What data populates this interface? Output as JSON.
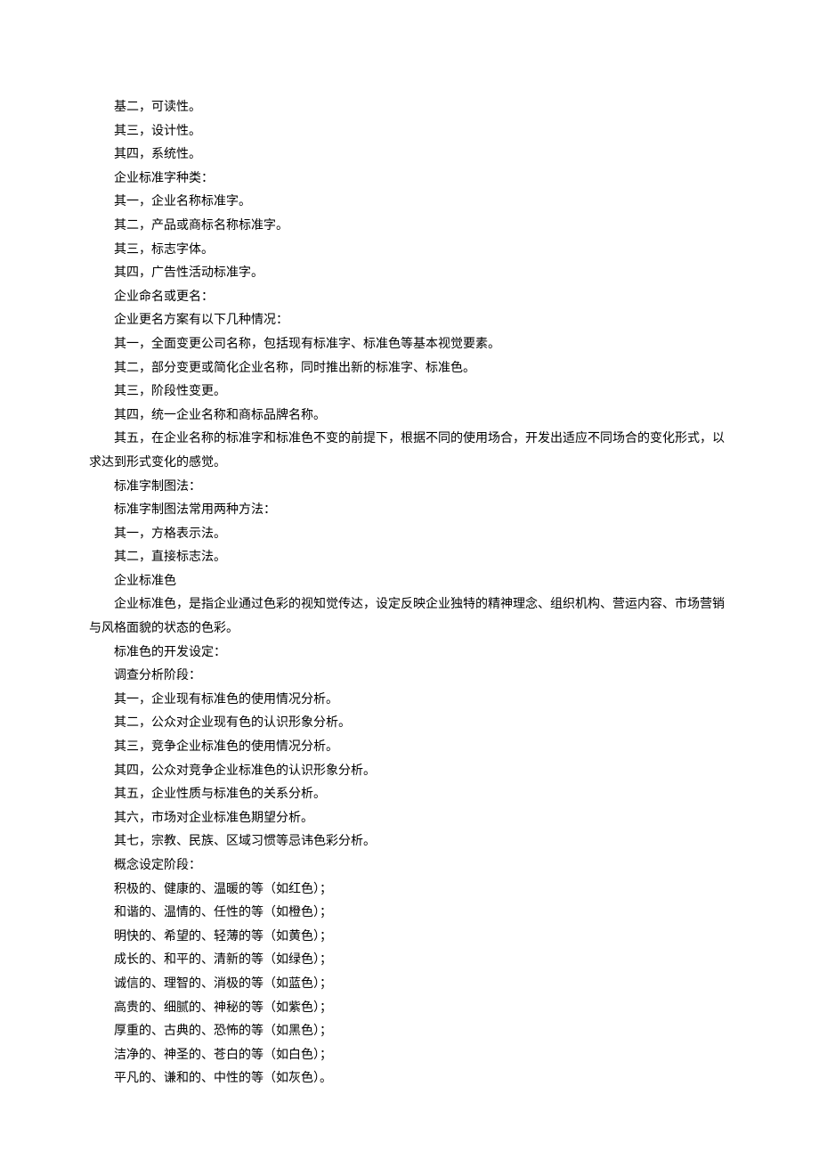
{
  "lines": [
    "基二，可读性。",
    "其三，设计性。",
    "其四，系统性。",
    "企业标准字种类：",
    "其一，企业名称标准字。",
    "其二，产品或商标名称标准字。",
    "其三，标志字体。",
    "其四，广告性活动标准字。",
    "企业命名或更名：",
    "企业更名方案有以下几种情况：",
    "其一，全面变更公司名称，包括现有标准字、标准色等基本视觉要素。",
    "其二，部分变更或简化企业名称，同时推出新的标准字、标准色。",
    "其三，阶段性变更。",
    "其四，统一企业名称和商标品牌名称。",
    "其五，在企业名称的标准字和标准色不变的前提下，根据不同的使用场合，开发出适应不同场合的变化形式，以求达到形式变化的感觉。",
    "标准字制图法：",
    "标准字制图法常用两种方法：",
    "其一，方格表示法。",
    "其二，直接标志法。",
    "企业标准色",
    "企业标准色，是指企业通过色彩的视知觉传达，设定反映企业独特的精神理念、组织机构、营运内容、市场营销与风格面貌的状态的色彩。",
    "标准色的开发设定：",
    "调查分析阶段：",
    "其一，企业现有标准色的使用情况分析。",
    "其二，公众对企业现有色的认识形象分析。",
    "其三，竞争企业标准色的使用情况分析。",
    "其四，公众对竞争企业标准色的认识形象分析。",
    "其五，企业性质与标准色的关系分析。",
    "其六，市场对企业标准色期望分析。",
    "其七，宗教、民族、区域习惯等忌讳色彩分析。",
    "概念设定阶段：",
    "积极的、健康的、温暖的等（如红色）；",
    "和谐的、温情的、任性的等（如橙色）；",
    "明快的、希望的、轻薄的等（如黄色）；",
    "成长的、和平的、清新的等（如绿色）；",
    "诚信的、理智的、消极的等（如蓝色）；",
    "高贵的、细腻的、神秘的等（如紫色）；",
    "厚重的、古典的、恐怖的等（如黑色）；",
    "洁净的、神圣的、苍白的等（如白色）；",
    "平凡的、谦和的、中性的等（如灰色）。"
  ]
}
